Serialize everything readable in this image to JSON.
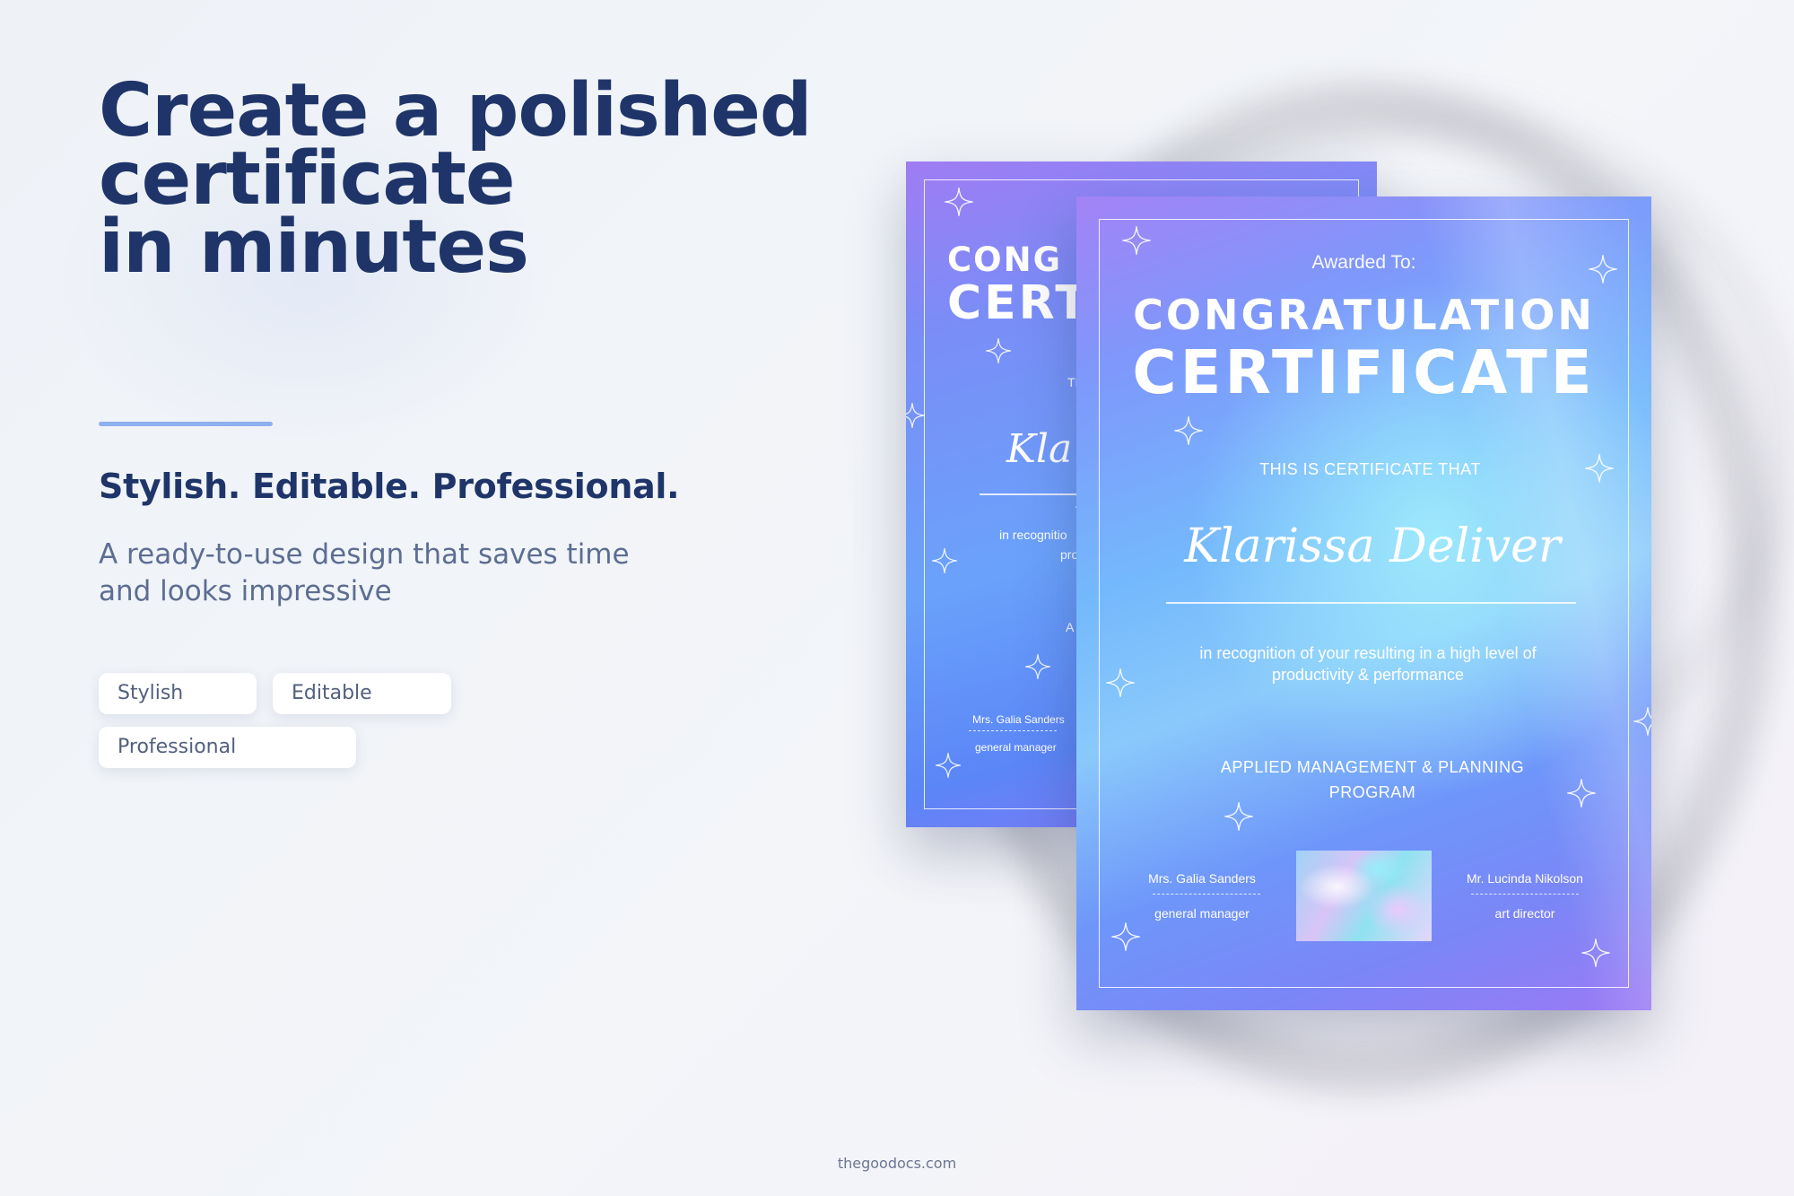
{
  "hero": {
    "headline_line1": "Create a polished",
    "headline_line2": "certificate",
    "headline_line3": "in minutes",
    "subheading": "Stylish. Editable. Professional.",
    "description": "A ready-to-use design that saves time and looks impressive"
  },
  "tags": [
    "Stylish",
    "Editable",
    "Professional"
  ],
  "certificate": {
    "awarded_to": "Awarded To:",
    "title_line1": "CONGRATULATION",
    "title_line2": "CERTIFICATE",
    "statement": "THIS IS CERTIFICATE THAT",
    "recipient": "Klarissa Deliver",
    "recognition": "in recognition of your resulting in a high level of productivity & performance",
    "program": "APPLIED MANAGEMENT & PLANNING PROGRAM",
    "signer1_name": "Mrs. Galia Sanders",
    "signer1_role": "general manager",
    "signer2_name": "Mr. Lucinda Nikolson",
    "signer2_role": "art director"
  },
  "back_certificate": {
    "title_line1": "CONG",
    "title_line2": "CERT",
    "statement": "TI",
    "recipient": "Kla",
    "recognition_line1": "in recognitio",
    "recognition_line2": "pro",
    "program": "A",
    "signer_name": "Mrs. Galia Sanders",
    "signer_role": "general manager"
  },
  "footer": {
    "site": "thegoodocs.com"
  },
  "colors": {
    "headline": "#1f3569",
    "body_text": "#5d6d92",
    "accent_divider": "#8fb0ef",
    "cert_purple": "#a383f6",
    "cert_cyan": "#8ac9fb",
    "cert_blue": "#6e96fa"
  },
  "icons": {
    "decoration": "sparkle-star-icon"
  }
}
